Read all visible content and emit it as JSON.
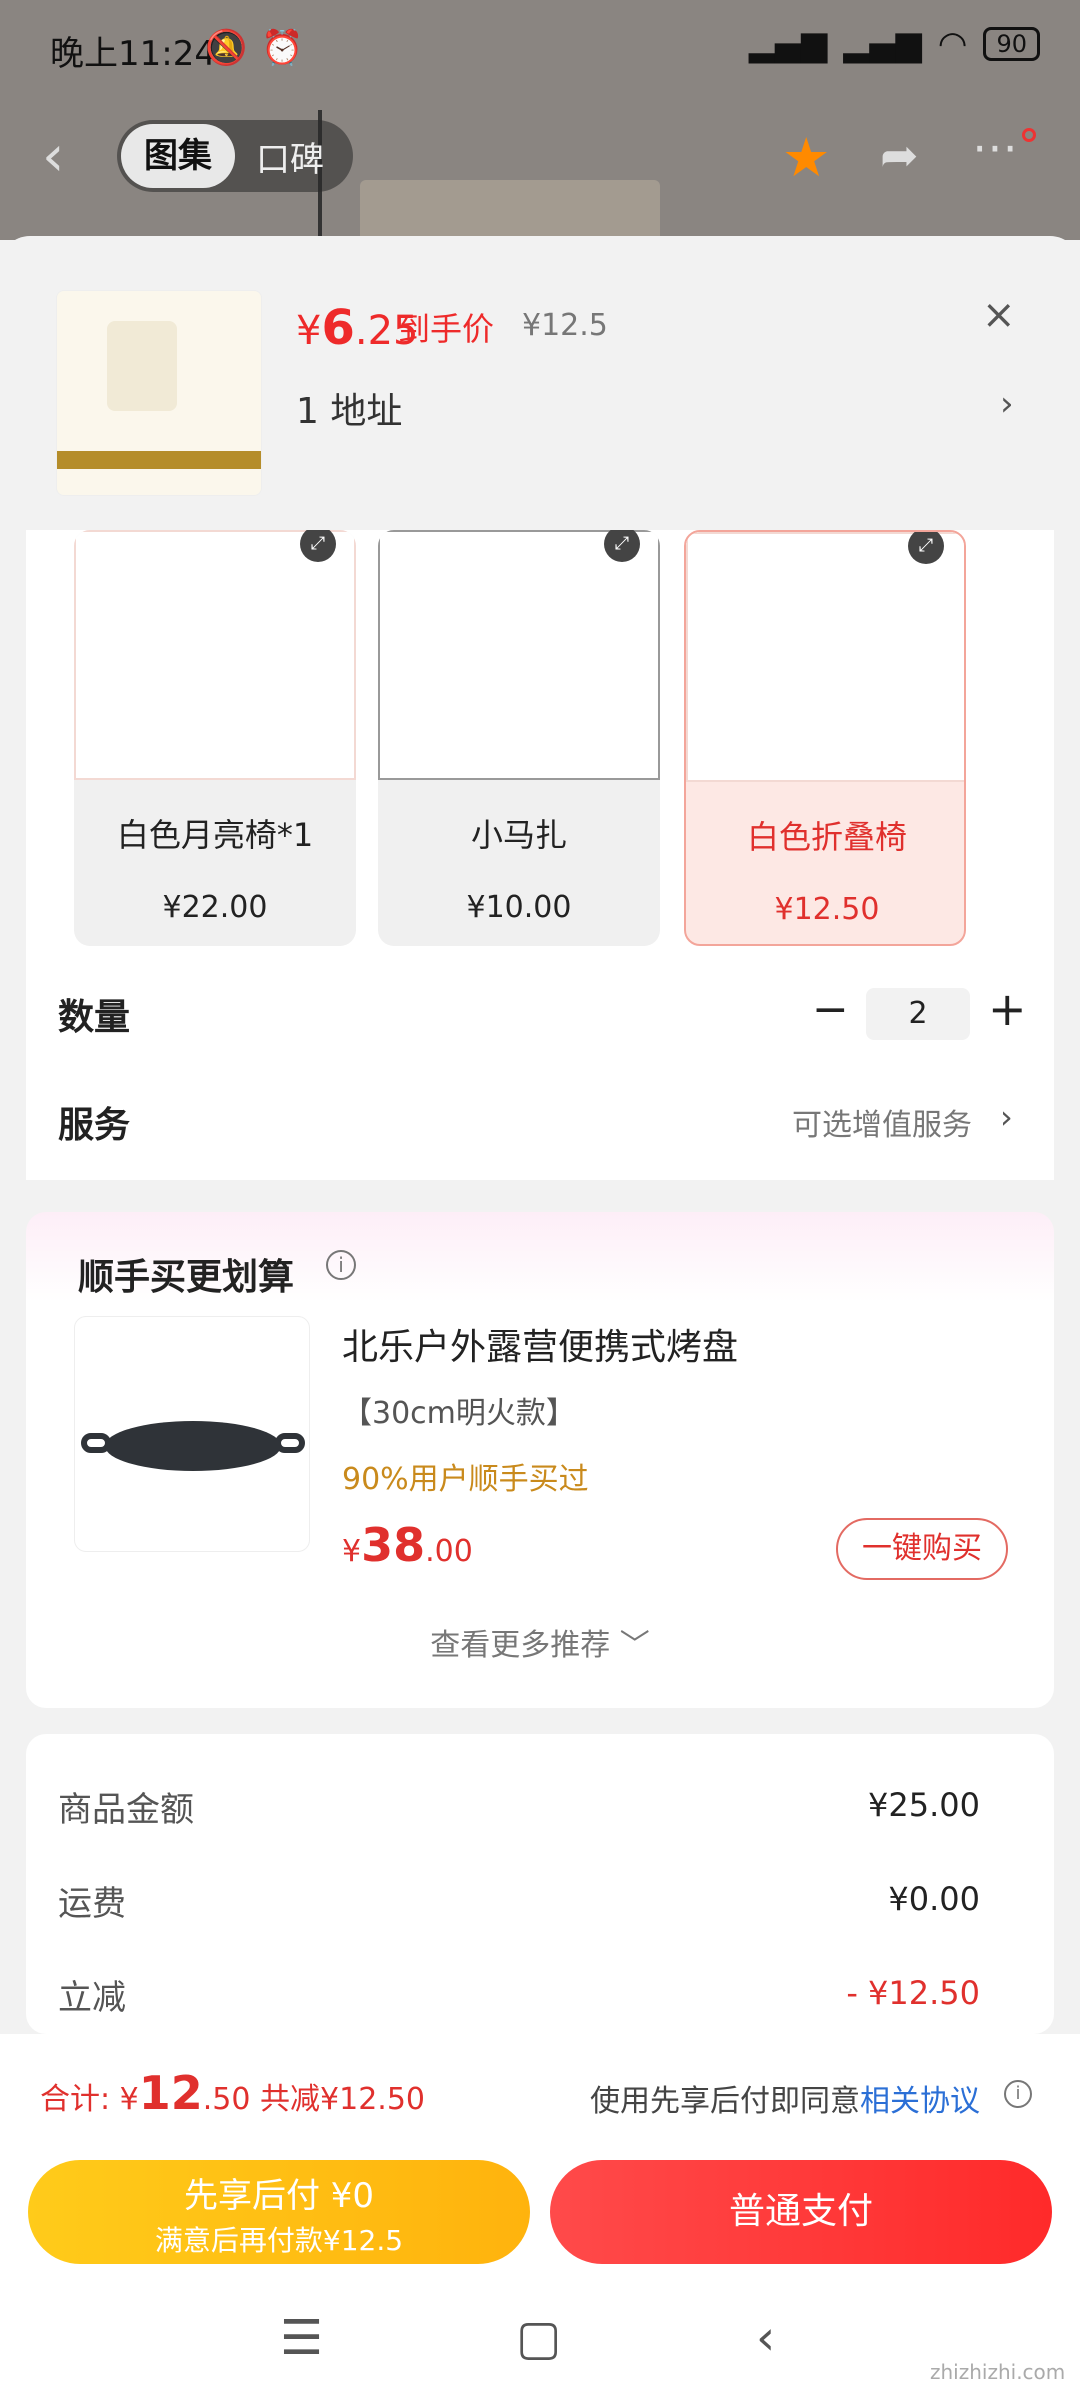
{
  "status": {
    "time": "晚上11:24",
    "battery": "90"
  },
  "topbar": {
    "tab_gallery": "图集",
    "tab_reviews": "口碑"
  },
  "sku_header": {
    "price_currency": "¥",
    "price_int": "6",
    "price_dec": ".25",
    "price_label": "到手价",
    "original_price": "¥12.5",
    "close": "×",
    "address": "1  地址",
    "address_arrow": "›"
  },
  "products": [
    {
      "name": "白色月亮椅*1",
      "price": "¥22.00",
      "selected": false
    },
    {
      "name": "小马扎",
      "price": "¥10.00",
      "selected": false
    },
    {
      "name": "白色折叠椅",
      "price": "¥12.50",
      "selected": true
    }
  ],
  "quantity": {
    "label": "数量",
    "value": "2",
    "minus": "−",
    "plus": "+"
  },
  "service": {
    "label": "服务",
    "hint": "可选增值服务",
    "arrow": "›"
  },
  "upsell": {
    "title": "顺手买更划算",
    "info": "i",
    "item_name": "北乐户外露营便携式烤盘",
    "item_spec": "【30cm明火款】",
    "item_stat": "90%用户顺手买过",
    "price_currency": "¥",
    "price_int": "38",
    "price_dec": ".00",
    "buy_label": "一键购买",
    "more_label": "查看更多推荐 ﹀"
  },
  "summary": {
    "goods_label": "商品金额",
    "goods_value": "¥25.00",
    "shipping_label": "运费",
    "shipping_value": "¥0.00",
    "discount_label": "立减",
    "discount_value": "- ¥12.50"
  },
  "bottom": {
    "total_label": "合计: ",
    "total_currency": "¥",
    "total_int": "12",
    "total_dec": ".50",
    "total_saved": "共减¥12.50",
    "agree_text": "使用先享后付即同意",
    "agree_link": "相关协议",
    "info": "i",
    "pay_later_title": "先享后付 ¥0",
    "pay_later_sub": "满意后再付款¥12.5",
    "pay_now": "普通支付"
  },
  "watermark": "zhizhizhi.com",
  "colors": {
    "accent": "#e0302d",
    "pay_later": "#ffbf14",
    "link": "#2b6fd6"
  }
}
